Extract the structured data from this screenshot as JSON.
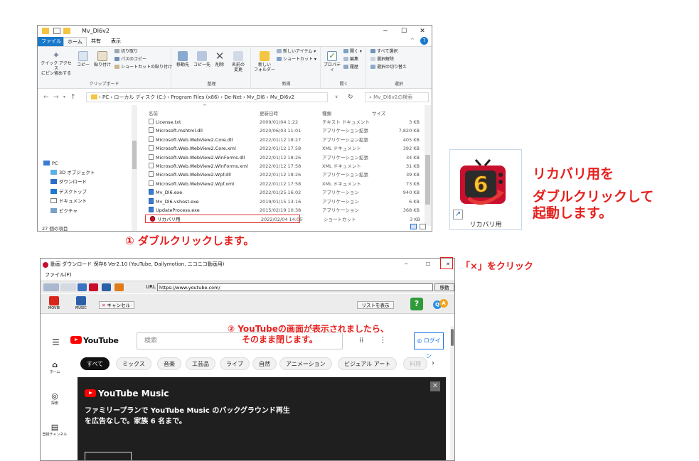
{
  "explorer": {
    "title": "Mv_Dl6v2",
    "tabs": [
      "ファイル",
      "ホーム",
      "共有",
      "表示"
    ],
    "ribbon": {
      "clipboard": {
        "label": "クリップボード",
        "pin": "クイック アクセス\nにピン留めする",
        "copy": "コピー",
        "paste": "貼り付け",
        "cut": "切り取り",
        "copy_path": "パスのコピー",
        "paste_shortcut": "ショートカットの貼り付け"
      },
      "organize": {
        "label": "整理",
        "move_to": "移動先",
        "copy_to": "コピー先",
        "delete": "削除",
        "rename": "名前の\n変更"
      },
      "new": {
        "label": "新規",
        "new_folder": "新しい\nフォルダー",
        "new_item": "新しいアイテム ▾",
        "shortcut": "ショートカット ▾"
      },
      "open": {
        "label": "開く",
        "properties": "プロパティ",
        "open": "開く ▾",
        "edit": "編集",
        "history": "履歴"
      },
      "select": {
        "label": "選択",
        "select_all": "すべて選択",
        "select_none": "選択解除",
        "invert": "選択の切り替え"
      }
    },
    "address_path": "›  PC  ›  ローカル ディスク (C:)  ›  Program Files (x86)  ›  De-Net  ›  Mv_Dl6  ›  Mv_Dl6v2",
    "search_placeholder": "Mv_Dl6v2の検索",
    "nav_items": [
      "PC",
      "3D オブジェクト",
      "ダウンロード",
      "デスクトップ",
      "ドキュメント",
      "ピクチャ"
    ],
    "columns": [
      "名前",
      "更新日時",
      "種類",
      "サイズ"
    ],
    "files": [
      {
        "name": "License.txt",
        "date": "2009/01/04 1:22",
        "type": "テキスト ドキュメント",
        "size": "3 KB"
      },
      {
        "name": "Microsoft.mshtml.dll",
        "date": "2020/06/03 11:01",
        "type": "アプリケーション拡張",
        "size": "7,820 KB"
      },
      {
        "name": "Microsoft.Web.WebView2.Core.dll",
        "date": "2022/01/12 18:27",
        "type": "アプリケーション拡張",
        "size": "405 KB"
      },
      {
        "name": "Microsoft.Web.WebView2.Core.xml",
        "date": "2022/01/12 17:58",
        "type": "XML ドキュメント",
        "size": "392 KB"
      },
      {
        "name": "Microsoft.Web.WebView2.WinForms.dll",
        "date": "2022/01/12 18:26",
        "type": "アプリケーション拡張",
        "size": "34 KB"
      },
      {
        "name": "Microsoft.Web.WebView2.WinForms.xml",
        "date": "2022/01/12 17:58",
        "type": "XML ドキュメント",
        "size": "31 KB"
      },
      {
        "name": "Microsoft.Web.WebView2.Wpf.dll",
        "date": "2022/01/12 18:26",
        "type": "アプリケーション拡張",
        "size": "39 KB"
      },
      {
        "name": "Microsoft.Web.WebView2.Wpf.xml",
        "date": "2022/01/12 17:58",
        "type": "XML ドキュメント",
        "size": "73 KB"
      },
      {
        "name": "Mv_Dl6.exe",
        "date": "2022/01/25 16:02",
        "type": "アプリケーション",
        "size": "940 KB"
      },
      {
        "name": "Mv_Dl6.vshost.exe",
        "date": "2019/01/15 13:16",
        "type": "アプリケーション",
        "size": "6 KB"
      },
      {
        "name": "UpdateProcess.exe",
        "date": "2015/02/19 10:38",
        "type": "アプリケーション",
        "size": "368 KB"
      },
      {
        "name": "リカバリ用",
        "date": "2022/02/04 14:05",
        "type": "ショートカット",
        "size": "3 KB"
      }
    ],
    "status": "27 個の項目"
  },
  "app_icon": {
    "number": "6",
    "label": "リカバリ用"
  },
  "callouts": {
    "icon_note_1": "リカバリ用を",
    "icon_note_2": "ダブルクリックして",
    "icon_note_3": "起動します。",
    "step1": "① ダブルクリックします。",
    "step2_line1": "② YouTubeの画面が表示されましたら、",
    "step2_line2": "そのまま閉じます。",
    "close_note": "「×」をクリック"
  },
  "app": {
    "title": "動画 ダウンロード 保存6 Ver2.10 (YouTube, Dailymotion, ニコニコ動画用)",
    "menu_file": "ファイル(F)",
    "url_label": "URL",
    "url": "https://www.youtube.com/",
    "go": "移動",
    "movie": "MOVIE",
    "music": "MUSIC",
    "cancel": "キャンセル",
    "list_show": "リストを表示",
    "help": "?",
    "youtube": {
      "logo": "YouTube",
      "search_placeholder": "検索",
      "login": "ログイン",
      "chips": [
        "すべて",
        "ミックス",
        "音楽",
        "工芸品",
        "ライブ",
        "自然",
        "アニメーション",
        "ビジュアル アート",
        "料理"
      ],
      "side": [
        {
          "icon": "⌂",
          "label": "ホーム"
        },
        {
          "icon": "◎",
          "label": "探索"
        },
        {
          "icon": "▤",
          "label": "登録チャンネル"
        }
      ],
      "promo_title": "YouTube Music",
      "promo_copy": "ファミリープランで YouTube Music のバックグラウンド再生を広告なしで。家族 6 名まで。"
    }
  },
  "colors": {
    "callout": "#e5211f",
    "file_tab": "#1979ca",
    "youtube_red": "#ff0000"
  }
}
